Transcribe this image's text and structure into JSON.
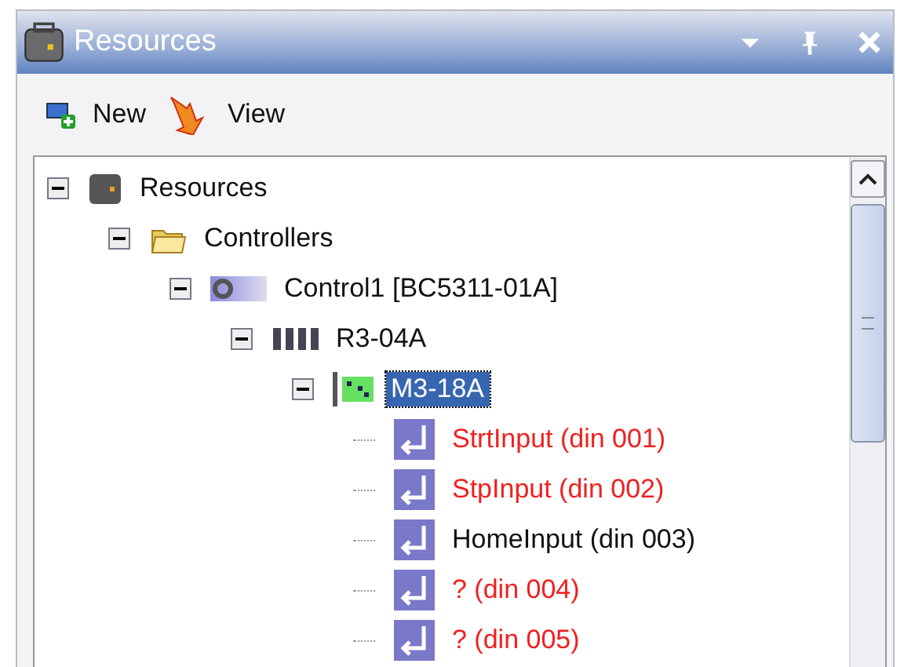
{
  "window": {
    "title": "Resources"
  },
  "toolbar": [
    {
      "kind": "new",
      "label": "New"
    },
    {
      "kind": "view",
      "label": "View"
    }
  ],
  "tree": [
    {
      "label": "Resources",
      "kind": "resources",
      "expanded": true,
      "selected": false,
      "error": false,
      "children": [
        {
          "label": "Controllers",
          "kind": "folder",
          "expanded": true,
          "selected": false,
          "error": false,
          "children": [
            {
              "label": "Control1 [BC5311-01A]",
              "kind": "controller",
              "expanded": true,
              "selected": false,
              "error": false,
              "children": [
                {
                  "label": "R3-04A",
                  "kind": "rack",
                  "expanded": true,
                  "selected": false,
                  "error": false,
                  "children": [
                    {
                      "label": "M3-18A",
                      "kind": "module",
                      "expanded": true,
                      "selected": true,
                      "error": false,
                      "children": [
                        {
                          "label": "StrtInput (din 001)",
                          "kind": "input",
                          "selected": false,
                          "error": true
                        },
                        {
                          "label": "StpInput (din 002)",
                          "kind": "input",
                          "selected": false,
                          "error": true
                        },
                        {
                          "label": "HomeInput (din 003)",
                          "kind": "input",
                          "selected": false,
                          "error": false
                        },
                        {
                          "label": "? (din 004)",
                          "kind": "input",
                          "selected": false,
                          "error": true
                        },
                        {
                          "label": "? (din 005)",
                          "kind": "input",
                          "selected": false,
                          "error": true
                        }
                      ]
                    }
                  ]
                }
              ]
            }
          ]
        }
      ]
    }
  ]
}
